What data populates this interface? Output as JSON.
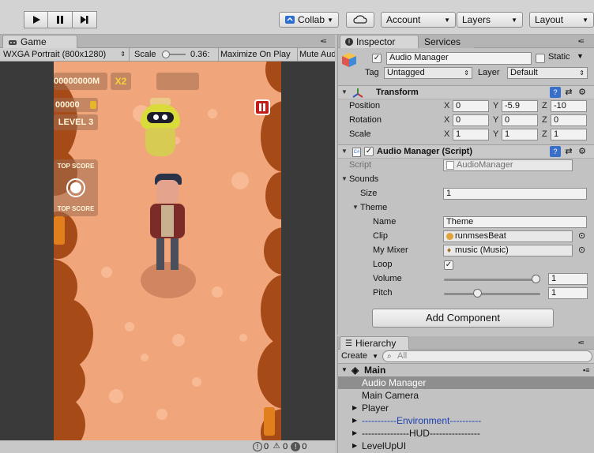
{
  "toolbar": {
    "collab_label": "Collab",
    "account_label": "Account",
    "layers_label": "Layers",
    "layout_label": "Layout"
  },
  "game_panel": {
    "tab_label": "Game",
    "resolution": "WXGA Portrait (800x1280)",
    "scale_label": "Scale",
    "scale_value": "0.36:",
    "maximize_label": "Maximize On Play",
    "mute_label": "Mute Aud"
  },
  "game_hud": {
    "score": "00000000M",
    "multiplier": "X2",
    "coins": "00000",
    "level": "LEVEL 3",
    "top_score_1": "TOP SCORE",
    "top_score_2": "TOP SCORE"
  },
  "status_bar": {
    "info_count": "0",
    "warning_count": "0",
    "error_count": "0"
  },
  "inspector": {
    "tab_label": "Inspector",
    "services_tab_label": "Services",
    "object_name": "Audio Manager",
    "static_label": "Static",
    "tag_label": "Tag",
    "tag_value": "Untagged",
    "layer_label": "Layer",
    "layer_value": "Default",
    "transform": {
      "title": "Transform",
      "position_label": "Position",
      "rotation_label": "Rotation",
      "scale_label": "Scale",
      "axis_x": "X",
      "axis_y": "Y",
      "axis_z": "Z",
      "position": {
        "x": "0",
        "y": "-5.9",
        "z": "-10"
      },
      "rotation": {
        "x": "0",
        "y": "0",
        "z": "0"
      },
      "scale": {
        "x": "1",
        "y": "1",
        "z": "1"
      }
    },
    "audio_manager": {
      "title": "Audio Manager (Script)",
      "script_label": "Script",
      "script_value": "AudioManager",
      "sounds_label": "Sounds",
      "size_label": "Size",
      "size_value": "1",
      "theme_label": "Theme",
      "name_label": "Name",
      "name_value": "Theme",
      "clip_label": "Clip",
      "clip_value": "runmsesBeat",
      "mixer_label": "My Mixer",
      "mixer_value": "music (Music)",
      "loop_label": "Loop",
      "loop_checked": true,
      "volume_label": "Volume",
      "volume_value": "1",
      "volume_fraction": 1.0,
      "pitch_label": "Pitch",
      "pitch_value": "1",
      "pitch_fraction": 0.33
    },
    "add_component_label": "Add Component"
  },
  "hierarchy": {
    "tab_label": "Hierarchy",
    "create_label": "Create",
    "search_placeholder": "All",
    "scene_name": "Main",
    "items": [
      {
        "label": "Audio Manager",
        "selected": true,
        "has_children": false,
        "color": "#111111"
      },
      {
        "label": "Main Camera",
        "selected": false,
        "has_children": false,
        "color": "#111111"
      },
      {
        "label": "Player",
        "selected": false,
        "has_children": true,
        "color": "#111111"
      },
      {
        "label": "-----------Environment----------",
        "selected": false,
        "has_children": true,
        "color": "#1a3fb0"
      },
      {
        "label": "---------------HUD----------------",
        "selected": false,
        "has_children": true,
        "color": "#111111"
      },
      {
        "label": "LevelUpUI",
        "selected": false,
        "has_children": true,
        "color": "#111111"
      }
    ]
  }
}
